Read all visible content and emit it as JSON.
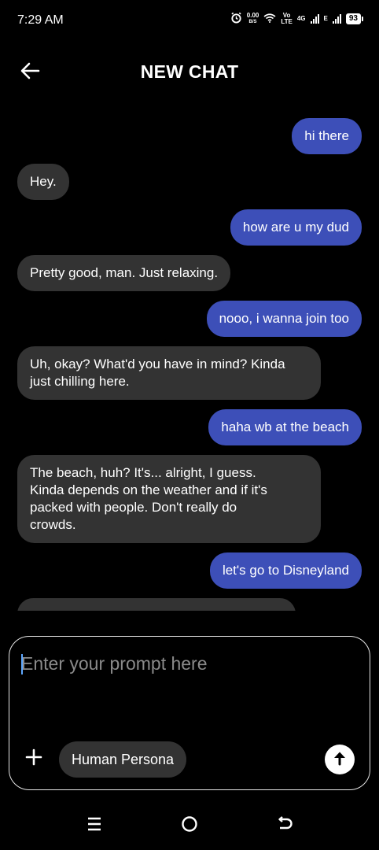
{
  "status_bar": {
    "time": "7:29 AM",
    "speed_value": "0.00",
    "speed_unit": "B/S",
    "volte_top": "Vo",
    "volte_bottom": "LTE",
    "network_4g": "4G",
    "network_e": "E",
    "battery": "93",
    "icons": [
      "alarm-icon",
      "wifi-icon",
      "signal-icon",
      "battery-icon"
    ]
  },
  "header": {
    "title": "NEW CHAT",
    "back_icon": "back-arrow-icon"
  },
  "messages": [
    {
      "role": "user",
      "text": "hi there"
    },
    {
      "role": "bot",
      "text": "Hey."
    },
    {
      "role": "user",
      "text": "how are u my dud"
    },
    {
      "role": "bot",
      "text": "Pretty good, man. Just relaxing."
    },
    {
      "role": "user",
      "text": "nooo, i wanna join too"
    },
    {
      "role": "bot",
      "text": "Uh, okay? What'd you have in mind? Kinda just chilling here."
    },
    {
      "role": "user",
      "text": "haha wb at the beach"
    },
    {
      "role": "bot",
      "text": "The beach, huh? It's... alright, I guess. Kinda depends on the weather and if it's packed with people. Don't really do crowds."
    },
    {
      "role": "user",
      "text": "let's go to Disneyland"
    }
  ],
  "composer": {
    "placeholder": "Enter your prompt here",
    "value": "",
    "persona_label": "Human Persona",
    "add_icon": "plus-icon",
    "send_icon": "arrow-up-icon"
  },
  "nav": {
    "icons": [
      "menu-icon",
      "home-icon",
      "back-icon"
    ]
  },
  "colors": {
    "background": "#000000",
    "user_bubble": "#3d4fb8",
    "bot_bubble": "#333333",
    "chip": "#333333",
    "text": "#ffffff",
    "placeholder": "#8a8a8a"
  }
}
